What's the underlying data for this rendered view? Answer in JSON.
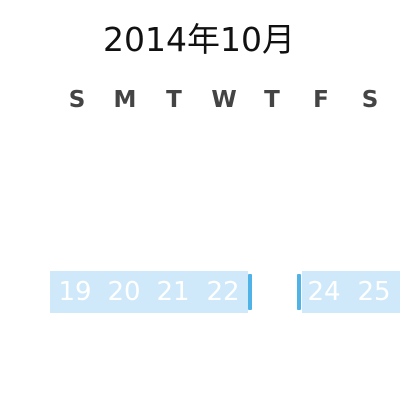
{
  "calendar": {
    "month_title": "2014年10月",
    "weekdays": [
      "S",
      "M",
      "T",
      "W",
      "T",
      "F",
      "S"
    ],
    "selected_week_days": [
      "19",
      "20",
      "21",
      "22",
      "24",
      "25"
    ]
  },
  "colors": {
    "selection_fill": "#cfe9fa",
    "selection_edge": "#4fb3e8",
    "day_text": "#ffffff",
    "weekday_text": "#444444"
  }
}
